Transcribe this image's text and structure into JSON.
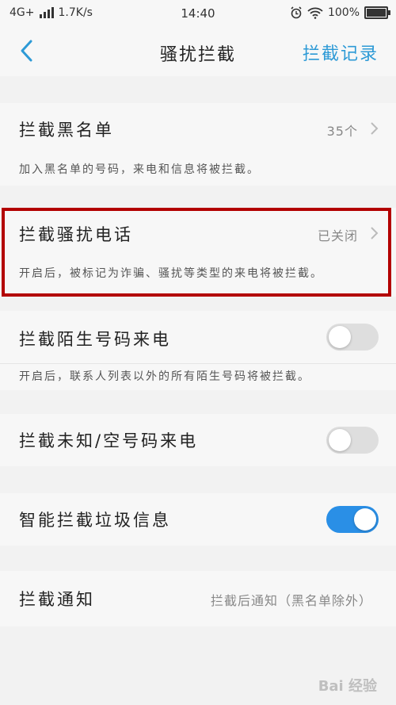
{
  "status_bar": {
    "network": "4G+",
    "speed": "1.7K/s",
    "time": "14:40",
    "battery": "100%"
  },
  "nav": {
    "title": "骚扰拦截",
    "action": "拦截记录",
    "accent_color": "#2d9ad6"
  },
  "settings": {
    "blacklist": {
      "label": "拦截黑名单",
      "value": "35个",
      "desc": "加入黑名单的号码，来电和信息将被拦截。"
    },
    "harassment_calls": {
      "label": "拦截骚扰电话",
      "value": "已关闭",
      "desc": "开启后，被标记为诈骗、骚扰等类型的来电将被拦截。"
    },
    "stranger_calls": {
      "label": "拦截陌生号码来电",
      "enabled": false,
      "desc": "开启后，联系人列表以外的所有陌生号码将被拦截。"
    },
    "unknown_calls": {
      "label": "拦截未知/空号码来电",
      "enabled": false
    },
    "spam_messages": {
      "label": "智能拦截垃圾信息",
      "enabled": true
    },
    "notification": {
      "label": "拦截通知",
      "value": "拦截后通知（黑名单除外）"
    }
  },
  "watermark": "Bai 经验"
}
